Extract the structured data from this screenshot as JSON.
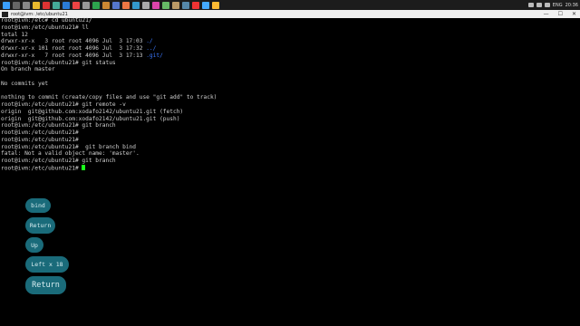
{
  "window": {
    "title": "root@ivm: /etc/ubuntu21",
    "min": "—",
    "max": "☐",
    "close": "✕"
  },
  "tray": {
    "lang": "ENG",
    "time": "20:36"
  },
  "terminal": {
    "lines": [
      "root@ivm:/etc# cd ubuntu21/",
      "root@ivm:/etc/ubuntu21# ll",
      "total 12",
      "drwxr-xr-x   3 root root 4096 Jul  3 17:03 ./",
      "drwxr-xr-x 101 root root 4096 Jul  3 17:32 ../",
      "drwxr-xr-x   7 root root 4096 Jul  3 17:13 .git/",
      "root@ivm:/etc/ubuntu21# git status",
      "On branch master",
      "",
      "No commits yet",
      "",
      "nothing to commit (create/copy files and use \"git add\" to track)",
      "root@ivm:/etc/ubuntu21# git remote -v",
      "origin  git@github.com:xodafo2142/ubuntu21.git (fetch)",
      "origin  git@github.com:xodafo2142/ubuntu21.git (push)",
      "root@ivm:/etc/ubuntu21# git branch",
      "root@ivm:/etc/ubuntu21#",
      "root@ivm:/etc/ubuntu21#",
      "root@ivm:/etc/ubuntu21#  git branch bind",
      "fatal: Not a valid object name: 'master'.",
      "root@ivm:/etc/ubuntu21# git branch",
      "root@ivm:/etc/ubuntu21# "
    ]
  },
  "keys": [
    {
      "label": "bind"
    },
    {
      "label": "Return"
    },
    {
      "label": "Up"
    },
    {
      "label": "Left x 18"
    },
    {
      "label": "Return"
    }
  ],
  "colors": {
    "key_bg": "#1a6b7a",
    "cursor": "#1aff1a",
    "dir": "#3b78ff"
  }
}
